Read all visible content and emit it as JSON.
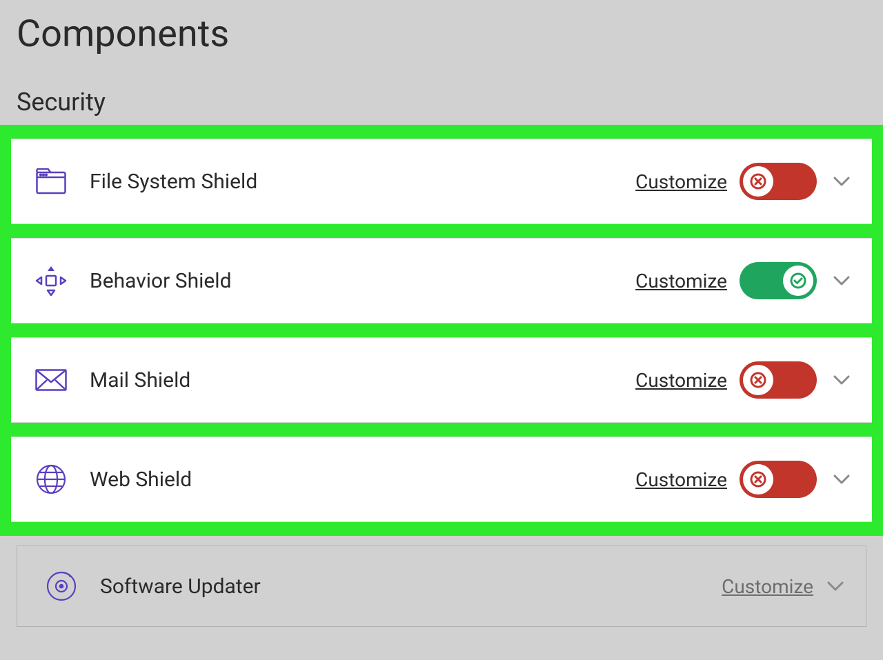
{
  "page": {
    "title": "Components"
  },
  "section": {
    "title": "Security"
  },
  "labels": {
    "customize": "Customize"
  },
  "colors": {
    "highlight": "#2eea2e",
    "iconPurple": "#5b3fbf",
    "toggleOff": "#c1352b",
    "toggleOn": "#20a55f"
  },
  "components": [
    {
      "id": "file-system-shield",
      "label": "File System Shield",
      "icon": "folder-icon",
      "state": "off"
    },
    {
      "id": "behavior-shield",
      "label": "Behavior Shield",
      "icon": "move-icon",
      "state": "on"
    },
    {
      "id": "mail-shield",
      "label": "Mail Shield",
      "icon": "mail-icon",
      "state": "off"
    },
    {
      "id": "web-shield",
      "label": "Web Shield",
      "icon": "globe-icon",
      "state": "off"
    }
  ],
  "extra": [
    {
      "id": "software-updater",
      "label": "Software Updater",
      "icon": "disc-icon"
    }
  ]
}
